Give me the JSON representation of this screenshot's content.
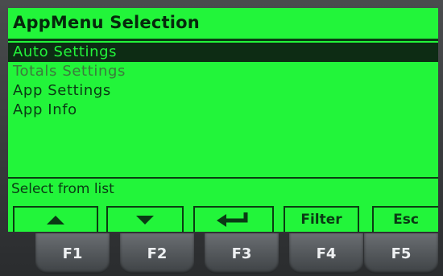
{
  "title": "AppMenu Selection",
  "menu_items": [
    {
      "label": "Auto Settings",
      "selected": true,
      "enabled": true
    },
    {
      "label": "Totals Settings",
      "selected": false,
      "enabled": false
    },
    {
      "label": "App Settings",
      "selected": false,
      "enabled": true
    },
    {
      "label": "App Info",
      "selected": false,
      "enabled": true
    }
  ],
  "status": "Select from list",
  "softkeys": [
    {
      "icon": "arrow-up-icon"
    },
    {
      "icon": "arrow-down-icon"
    },
    {
      "icon": "enter-icon"
    },
    {
      "label": "Filter"
    },
    {
      "label": "Esc"
    }
  ],
  "function_keys": [
    "F1",
    "F2",
    "F3",
    "F4",
    "F5"
  ],
  "colors": {
    "lcd_background": "#22f53a",
    "lcd_text": "#0a3a14",
    "selection": "#0d2c14"
  }
}
